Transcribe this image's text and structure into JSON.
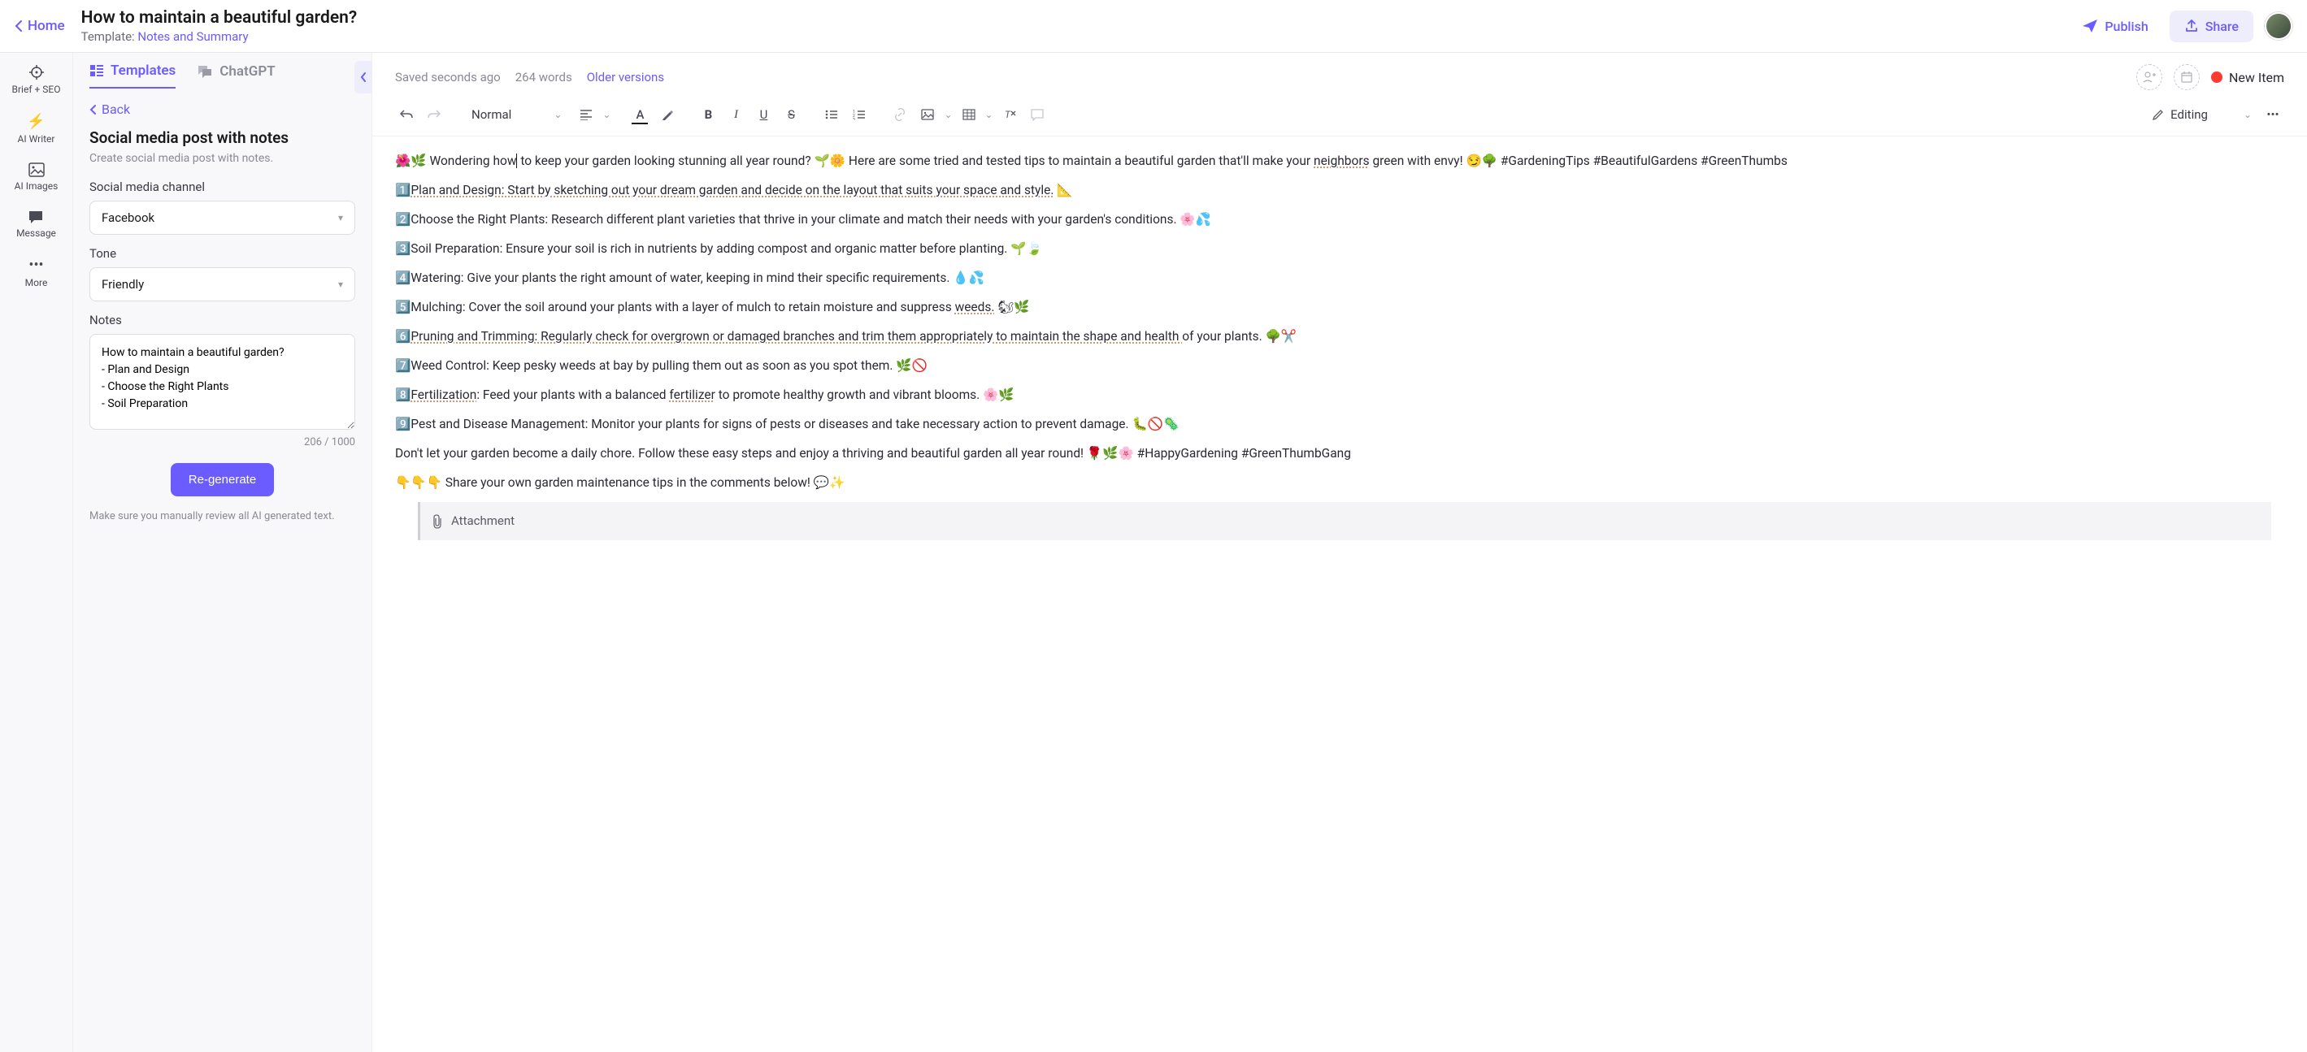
{
  "header": {
    "home": "Home",
    "title": "How to maintain a beautiful garden?",
    "template_prefix": "Template: ",
    "template_name": "Notes and Summary",
    "publish": "Publish",
    "share": "Share"
  },
  "rail": {
    "brief": "Brief + SEO",
    "writer": "AI Writer",
    "images": "AI Images",
    "message": "Message",
    "more": "More"
  },
  "panel": {
    "tab_templates": "Templates",
    "tab_chatgpt": "ChatGPT",
    "back": "Back",
    "title": "Social media post with notes",
    "subtitle": "Create social media post with notes.",
    "channel_label": "Social media channel",
    "channel_value": "Facebook",
    "tone_label": "Tone",
    "tone_value": "Friendly",
    "notes_label": "Notes",
    "notes_value": "How to maintain a beautiful garden?\n- Plan and Design\n- Choose the Right Plants\n- Soil Preparation",
    "counter": "206 / 1000",
    "regenerate": "Re-generate",
    "warning": "Make sure you manually review all AI generated text."
  },
  "editor": {
    "saved": "Saved seconds ago",
    "words": "264 words",
    "older": "Older versions",
    "new_item": "New Item",
    "style": "Normal",
    "mode": "Editing",
    "attachment": "Attachment",
    "p1a": "🌺🌿 Wondering how",
    "p1b": " to keep your garden looking stunning all year round? 🌱🌼 Here are some tried and tested tips to maintain a beautiful garden that'll make your ",
    "p1c": "neighbors",
    "p1d": " green with envy! 😏🌳 #GardeningTips #BeautifulGardens #GreenThumbs",
    "p2a": "1️⃣",
    "p2b": "Plan and Design: Start by sketching out your dream garden and decide on the layout that suits your space and style.",
    "p2c": " 📐",
    "p3": "2️⃣Choose the Right Plants: Research different plant varieties that thrive in your climate and match their needs with your garden's conditions. 🌸💦",
    "p4": "3️⃣Soil Preparation: Ensure your soil is rich in nutrients by adding compost and organic matter before planting. 🌱🍃",
    "p5": "4️⃣Watering: Give your plants the right amount of water, keeping in mind their specific requirements. 💧💦",
    "p6a": "5️⃣Mulching: Cover the soil around your plants with a layer of mulch to retain moisture and suppress ",
    "p6b": "weeds.",
    "p6c": " 🐿🌿",
    "p7a": "6️⃣",
    "p7b": "Pruning and Trimming: Regularly check for overgrown or damaged branches and trim them appropriately to maintain the shape and health ",
    "p7c": "of your plants. 🌳✂️",
    "p8": "7️⃣Weed Control: Keep pesky weeds at bay by pulling them out as soon as you spot them. 🌿🚫",
    "p9a": "8️⃣",
    "p9b": "Fertilization",
    "p9c": ": Feed your plants with a balanced ",
    "p9d": "fertilizer",
    "p9e": " to promote healthy growth and vibrant blooms. 🌸🌿",
    "p10": "9️⃣Pest and Disease Management: Monitor your plants for signs of pests or diseases and take necessary action to prevent damage. 🐛🚫🦠",
    "p11": "Don't let your garden become a daily chore. Follow these easy steps and enjoy a thriving and beautiful garden all year round! 🌹🌿🌸 #HappyGardening #GreenThumbGang",
    "p12": "👇👇👇 Share your own garden maintenance tips in the comments below! 💬✨"
  }
}
